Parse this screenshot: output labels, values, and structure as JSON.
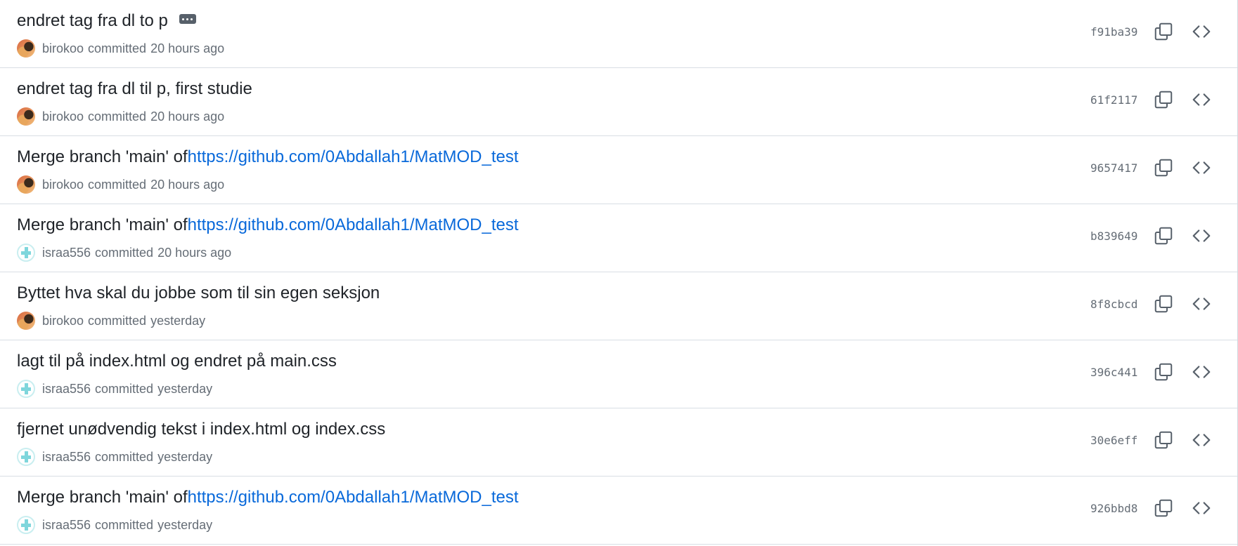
{
  "commits": [
    {
      "message": "endret tag fra dl to p",
      "link": "",
      "author": "birokoo",
      "action": "committed",
      "time": "20 hours ago",
      "avatar": "a1",
      "sha": "f91ba39",
      "has_ellipsis": true
    },
    {
      "message": "endret tag fra dl til p, first studie",
      "link": "",
      "author": "birokoo",
      "action": "committed",
      "time": "20 hours ago",
      "avatar": "a1",
      "sha": "61f2117"
    },
    {
      "message": "Merge branch 'main' of ",
      "link": "https://github.com/0Abdallah1/MatMOD_test",
      "author": "birokoo",
      "action": "committed",
      "time": "20 hours ago",
      "avatar": "a1",
      "sha": "9657417"
    },
    {
      "message": "Merge branch 'main' of ",
      "link": "https://github.com/0Abdallah1/MatMOD_test",
      "author": "israa556",
      "action": "committed",
      "time": "20 hours ago",
      "avatar": "a2",
      "sha": "b839649"
    },
    {
      "message": "Byttet hva skal du jobbe som til sin egen seksjon",
      "link": "",
      "author": "birokoo",
      "action": "committed",
      "time": "yesterday",
      "avatar": "a1",
      "sha": "8f8cbcd"
    },
    {
      "message": "lagt til på index.html og endret på main.css",
      "link": "",
      "author": "israa556",
      "action": "committed",
      "time": "yesterday",
      "avatar": "a2",
      "sha": "396c441"
    },
    {
      "message": "fjernet unødvendig tekst i index.html og index.css",
      "link": "",
      "author": "israa556",
      "action": "committed",
      "time": "yesterday",
      "avatar": "a2",
      "sha": "30e6eff"
    },
    {
      "message": "Merge branch 'main' of ",
      "link": "https://github.com/0Abdallah1/MatMOD_test",
      "author": "israa556",
      "action": "committed",
      "time": "yesterday",
      "avatar": "a2",
      "sha": "926bbd8"
    }
  ],
  "icons": {
    "copy": "copy-icon",
    "browse": "code-icon",
    "ellipsis": "ellipsis-icon"
  },
  "colors": {
    "link": "#0969da",
    "text": "#1f2328",
    "muted": "#656d76",
    "border": "#d8dee4"
  }
}
